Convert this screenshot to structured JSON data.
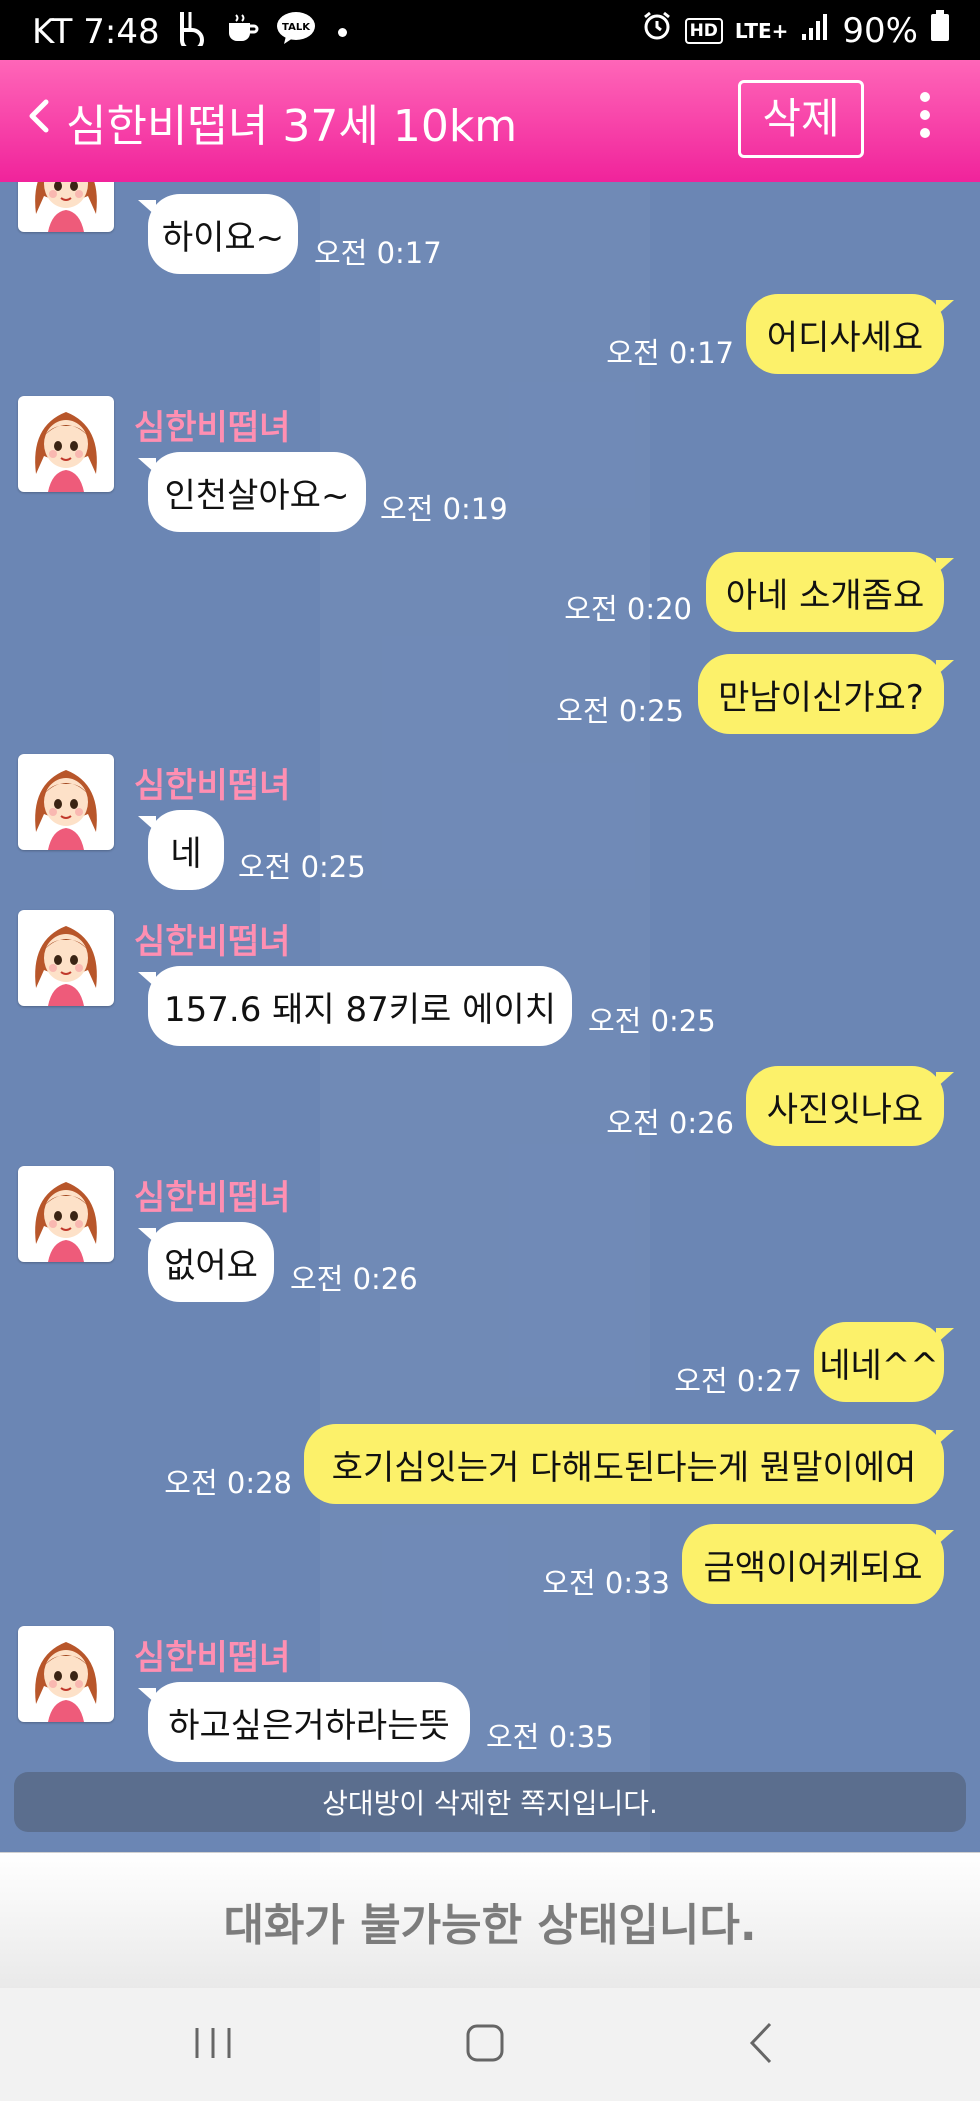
{
  "status_bar": {
    "carrier_time": "KT 7:48",
    "talk_badge": "TALK",
    "network": "LTE+",
    "hd": "HD",
    "battery": "90%"
  },
  "header": {
    "title": "심한비떱녀 37세 10km",
    "delete_label": "삭제"
  },
  "messages": [
    {
      "dir": "in",
      "sender": "",
      "text": "하이요~",
      "time": "오전 0:17"
    },
    {
      "dir": "out",
      "text": "어디사세요",
      "time": "오전 0:17"
    },
    {
      "dir": "in",
      "sender": "심한비떱녀",
      "text": "인천살아요~",
      "time": "오전 0:19"
    },
    {
      "dir": "out",
      "text": "아네 소개좀요",
      "time": "오전 0:20"
    },
    {
      "dir": "out",
      "text": "만남이신가요?",
      "time": "오전 0:25"
    },
    {
      "dir": "in",
      "sender": "심한비떱녀",
      "text": "네",
      "time": "오전 0:25"
    },
    {
      "dir": "in",
      "sender": "심한비떱녀",
      "text": "157.6  돼지 87키로 에이치",
      "time": "오전 0:25"
    },
    {
      "dir": "out",
      "text": "사진잇나요",
      "time": "오전 0:26"
    },
    {
      "dir": "in",
      "sender": "심한비떱녀",
      "text": "없어요",
      "time": "오전 0:26"
    },
    {
      "dir": "out",
      "text": "네네^^",
      "time": "오전 0:27"
    },
    {
      "dir": "out",
      "text": "호기심잇는거 다해도된다는게 뭔말이에여",
      "time": "오전 0:28"
    },
    {
      "dir": "out",
      "text": "금액이어케되요",
      "time": "오전 0:33"
    },
    {
      "dir": "in",
      "sender": "심한비떱녀",
      "text": "하고싶은거하라는뜻",
      "time": "오전 0:35"
    }
  ],
  "notice": "상대방이 삭제한 쪽지입니다.",
  "disabled_text": "대화가 불가능한 상태입니다.",
  "colors": {
    "header": "#f0239b",
    "chat_bg": "#6b86b4",
    "outgoing_bubble": "#fcf16a",
    "incoming_bubble": "#ffffff",
    "sender_name": "#ff8fb2"
  }
}
